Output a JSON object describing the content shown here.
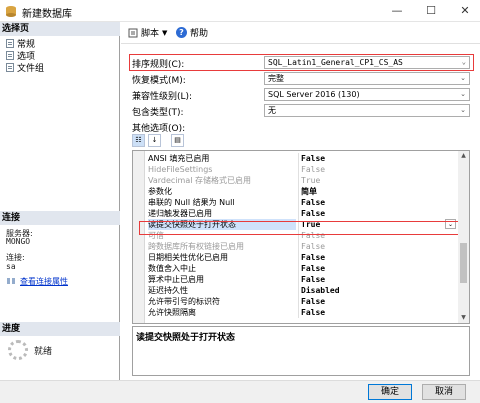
{
  "window": {
    "title": "新建数据库",
    "minimize": "—",
    "maximize": "☐",
    "close": "✕"
  },
  "left": {
    "select_page_header": "选择页",
    "pages": [
      {
        "label": "常规",
        "icon": "page-icon"
      },
      {
        "label": "选项",
        "icon": "page-icon"
      },
      {
        "label": "文件组",
        "icon": "page-icon"
      }
    ],
    "connection_header": "连接",
    "server_label": "服务器:",
    "server_value": "MONGO",
    "conn_label": "连接:",
    "conn_value": "sa",
    "view_conn_link": "查看连接属性",
    "progress_header": "进度",
    "progress_status": "就绪"
  },
  "toolbar": {
    "script_label": "脚本",
    "help_label": "帮助"
  },
  "form": {
    "collation_label": "排序规则(C):",
    "collation_value": "SQL_Latin1_General_CP1_CS_AS",
    "recovery_label": "恢复模式(M):",
    "recovery_value": "完整",
    "compat_label": "兼容性级别(L):",
    "compat_value": "SQL Server 2016 (130)",
    "containment_label": "包含类型(T):",
    "containment_value": "无",
    "other_options_label": "其他选项(O):"
  },
  "grid": {
    "rows": [
      {
        "key": "ANSI 填充已启用",
        "value": "False",
        "style": "normal"
      },
      {
        "key": "HideFileSettings",
        "value": "False",
        "style": "gray"
      },
      {
        "key": "Vardecimal 存储格式已启用",
        "value": "True",
        "style": "gray"
      },
      {
        "key": "参数化",
        "value": "简单",
        "style": "normal"
      },
      {
        "key": "串联的 Null 结果为 Null",
        "value": "False",
        "style": "normal"
      },
      {
        "key": "递归触发器已启用",
        "value": "False",
        "style": "normal"
      },
      {
        "key": "读提交快照处于打开状态",
        "value": "True",
        "style": "sel"
      },
      {
        "key": "可信",
        "value": "False",
        "style": "gray"
      },
      {
        "key": "跨数据库所有权链接已启用",
        "value": "False",
        "style": "gray"
      },
      {
        "key": "日期相关性优化已启用",
        "value": "False",
        "style": "normal"
      },
      {
        "key": "数值舍入中止",
        "value": "False",
        "style": "normal"
      },
      {
        "key": "算术中止已启用",
        "value": "False",
        "style": "normal"
      },
      {
        "key": "延迟持久性",
        "value": "Disabled",
        "style": "normal"
      },
      {
        "key": "允许带引号的标识符",
        "value": "False",
        "style": "normal"
      },
      {
        "key": "允许快照隔离",
        "value": "False",
        "style": "normal"
      }
    ]
  },
  "description": "读提交快照处于打开状态",
  "buttons": {
    "ok": "确定",
    "cancel": "取消"
  }
}
